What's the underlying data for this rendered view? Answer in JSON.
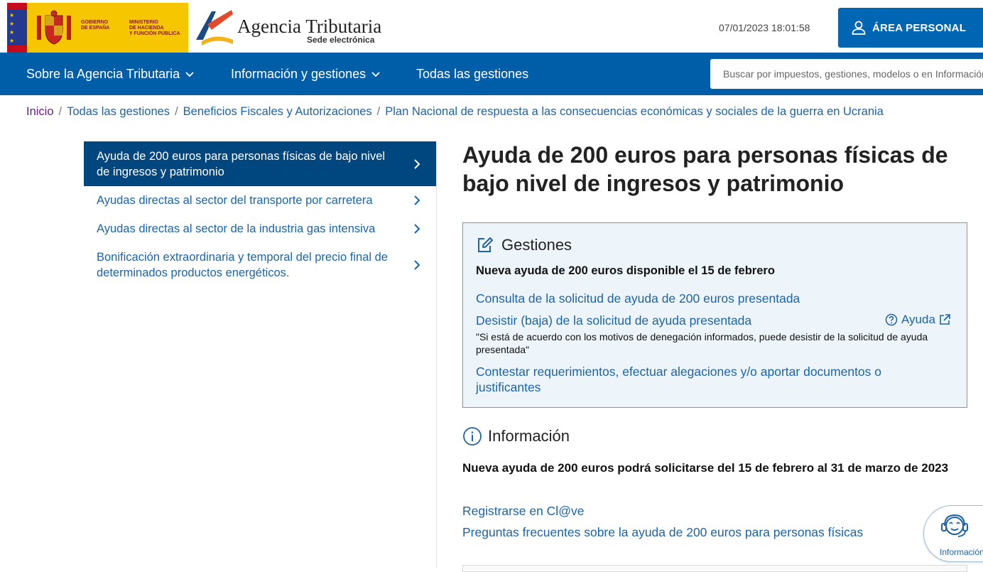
{
  "header": {
    "gov_line1": "GOBIERNO\nDE ESPAÑA",
    "gov_line2": "MINISTERIO\nDE HACIENDA\nY FUNCIÓN PÚBLICA",
    "agency_title": "Agencia Tributaria",
    "agency_subtitle": "Sede electrónica",
    "datetime": "07/01/2023 18:01:58",
    "area_personal": "ÁREA PERSONAL"
  },
  "nav": {
    "items": [
      {
        "label": "Sobre la Agencia Tributaria",
        "has_dropdown": true
      },
      {
        "label": "Información y gestiones",
        "has_dropdown": true
      },
      {
        "label": "Todas las gestiones",
        "has_dropdown": false
      }
    ],
    "search_placeholder": "Buscar por impuestos, gestiones, modelos o en Información"
  },
  "breadcrumb": {
    "items": [
      "Inicio",
      "Todas las gestiones",
      "Beneficios Fiscales y Autorizaciones",
      "Plan Nacional de respuesta a las consecuencias económicas y sociales de la guerra en Ucrania"
    ]
  },
  "sidebar": {
    "items": [
      {
        "label": "Ayuda de 200 euros para personas físicas de bajo nivel de ingresos y patrimonio",
        "active": true
      },
      {
        "label": "Ayudas directas al sector del transporte por carretera",
        "active": false
      },
      {
        "label": "Ayudas directas al sector de la industria gas intensiva",
        "active": false
      },
      {
        "label": "Bonificación extraordinaria y temporal del precio final de determinados productos energéticos.",
        "active": false
      }
    ]
  },
  "main": {
    "title": "Ayuda de 200 euros para personas físicas de bajo nivel de ingresos y patrimonio",
    "gestiones": {
      "heading": "Gestiones",
      "notice": "Nueva ayuda de 200 euros disponible el 15 de febrero",
      "link_consulta": "Consulta de la solicitud de ayuda de 200 euros presentada",
      "link_desistir": "Desistir (baja) de la solicitud de ayuda presentada",
      "ayuda_label": "Ayuda",
      "quote": "\"Si está de acuerdo con los motivos de denegación informados, puede desistir de la solicitud de ayuda presentada\"",
      "link_contestar": "Contestar requerimientos, efectuar alegaciones y/o aportar documentos o justificantes"
    },
    "informacion": {
      "heading": "Información",
      "notice": "Nueva ayuda de 200 euros podrá solicitarse del 15 de febrero al 31 de marzo de 2023",
      "link_clave": "Registrarse en Cl@ve",
      "link_faq": "Preguntas frecuentes sobre la ayuda de 200 euros para personas físicas"
    }
  },
  "help_widget": {
    "label": "Información"
  },
  "colors": {
    "primary_blue": "#005ea8",
    "active_blue": "#00477f",
    "link_blue": "#1c63a8",
    "gov_yellow": "#f6c700"
  }
}
